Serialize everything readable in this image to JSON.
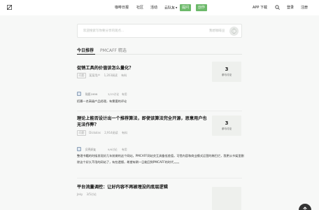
{
  "header": {
    "nav": [
      {
        "label": "咖啡日报"
      },
      {
        "label": "社区"
      },
      {
        "label": "活动"
      },
      {
        "label": "云队友"
      }
    ],
    "ask_button": "提问",
    "write_button": "创作",
    "app_download": "APP 下载",
    "login": "登录",
    "register": "注册"
  },
  "search": {
    "placeholder": "欢迎搜索写你要分享的观点...",
    "ask_label": "我想咖啡豆"
  },
  "tabs": [
    {
      "label": "今日推荐"
    },
    {
      "label": "PMCAFF 精选"
    }
  ],
  "feed": [
    {
      "title": "促销工具的价值该怎么量化？",
      "tag": "问题",
      "meta": [
        "某某用户",
        "1,203阅读",
        "有料"
      ],
      "answers": "3",
      "answers_label": "参与讨论",
      "answer": {
        "name": "陆医1999",
        "date": "3/23讨论",
        "vote": "有用",
        "text": "招募一名高级产品经理，有需要的评论"
      }
    },
    {
      "title": "理论上能否设计出一个推荐算法，即使该算法完全开源，恶意用户也无法作弊？",
      "tag": "问题",
      "meta": [
        "Dickolas",
        "2,914阅读",
        "有料"
      ],
      "answers": "3",
      "answers_label": "参与讨论",
      "answer": {
        "name": "贝壳好友",
        "date": "9/6讨论",
        "vote": "有用",
        "text": "整理书籍的时候发现好几年前做的这个网站，PMCAFF网站交互具备低差值，可惜内容和商业模式运营的稀巴烂，我更从书架里删除这个好久不用的网站了，有些遗憾，希望有朝一日能回到PMCAFF的时代，。。。"
      }
    },
    {
      "title": "平台流量调控：让好内容不再被埋没的底层逻辑",
      "tag": "",
      "meta": [
        "Jeky",
        "3/5讨论"
      ],
      "answers": "",
      "answers_label": ""
    }
  ]
}
